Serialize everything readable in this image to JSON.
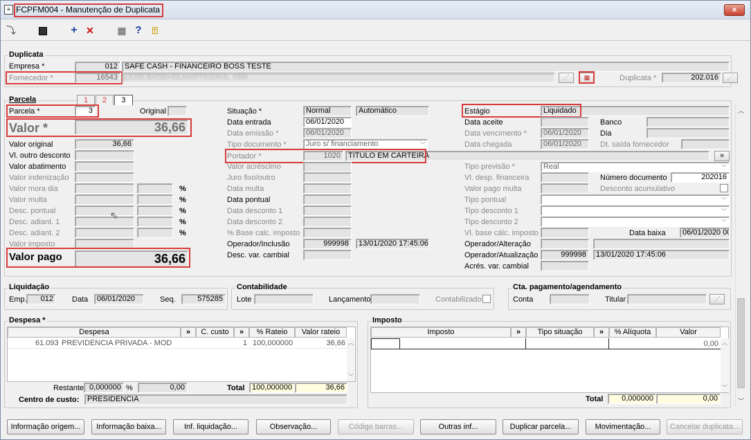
{
  "window": {
    "title": "FCPFM004 - Manutenção de Duplicata",
    "close": "×"
  },
  "toolbar": {
    "icons": [
      "goto-icon",
      "save-icon",
      "add-icon",
      "delete-icon",
      "calculator-icon",
      "help-icon",
      "exit-icon"
    ],
    "glyphs": {
      "goto": "⤵",
      "save": "💾",
      "add": "+",
      "delete": "✕",
      "calc": "▦",
      "help": "?",
      "exit": "⍐"
    }
  },
  "duplicata": {
    "section": "Duplicata",
    "empresa_label": "Empresa *",
    "empresa_code": "012",
    "empresa_name": "SAFE CASH - FINANCEIRO BOSS TESTE",
    "fornecedor_label": "Fornecedor *",
    "fornecedor_code": "16543",
    "fornecedor_name": "LKSR BXDEHDLMXPTEIDR4L XBR",
    "duplicata_label": "Duplicata *",
    "duplicata_value": "202.016"
  },
  "parcela": {
    "section": "Parcela",
    "tabs": [
      "1",
      "2",
      "3"
    ],
    "parcela_label": "Parcela *",
    "parcela_value": "3",
    "original_label": "Original",
    "valor_label": "Valor *",
    "valor_value": "36,66",
    "valor_original_label": "Valor original",
    "valor_original": "36,66",
    "left_labels": [
      "Vl. outro desconto",
      "Valor abatimento",
      "Valor indenização",
      "Valor mora dia",
      "Valor multa",
      "Desc. pontual",
      "Desc. adiant. 1",
      "Desc. adiant. 2",
      "Valor imposto"
    ],
    "pct": "%",
    "valor_pago_label": "Valor pago",
    "valor_pago_value": "36,66",
    "situacao_label": "Situação *",
    "situacao_value": "Normal",
    "situacao_tipo": "Automático",
    "data_entrada_label": "Data entrada",
    "data_entrada": "06/01/2020",
    "data_emissao_label": "Data emissão *",
    "data_emissao": "06/01/2020",
    "tipo_documento_label": "Tipo documento *",
    "tipo_documento": "Juro s/ financiamento",
    "portador_label": "Portador *",
    "portador_code": "1020",
    "portador_name": "TITULO EM CARTEIRA",
    "mid_labels": [
      "Valor acréscimo",
      "Juro fixo/outro",
      "Data multa",
      "Data pontual",
      "Data desconto 1",
      "Data desconto 2",
      "% Base calc. imposto"
    ],
    "operador_inclusao_label": "Operador/Inclusão",
    "operador_inclusao": "999998",
    "operador_inclusao_data": "13/01/2020 17:45:06",
    "desc_var_cambial_label": "Desc. var. cambial",
    "estagio_label": "Estágio",
    "estagio_value": "Liquidado",
    "data_aceite_label": "Data aceite",
    "banco_label": "Banco",
    "data_vencimento_label": "Data vencimento *",
    "data_vencimento": "06/01/2020",
    "dia_label": "Dia",
    "data_chegada_label": "Data chegada",
    "data_chegada": "06/01/2020",
    "dt_saida_label": "Dt. saída fornecedor",
    "tipo_previsao_label": "Tipo previsão *",
    "tipo_previsao": "Real",
    "vl_desp_fin_label": "Vl. desp. financeira",
    "numero_documento_label": "Número documento",
    "numero_documento": "202016",
    "valor_pago_multa_label": "Valor pago multa",
    "desconto_acumulativo_label": "Desconto acumulativo",
    "right_labels": [
      "Tipo pontual",
      "Tipo desconto 1",
      "Tipo desconto 2",
      "Vl. base cálc. imposto"
    ],
    "data_baixa_label": "Data baixa",
    "data_baixa": "06/01/2020 00",
    "operador_alteracao_label": "Operador/Alteração",
    "operador_atualizacao_label": "Operador/Atualização",
    "operador_atualizacao": "999998",
    "operador_atualizacao_data": "13/01/2020 17:45:06",
    "acres_var_cambial_label": "Acrés. var. cambial",
    "portador_btn": "»"
  },
  "liquidacao": {
    "section": "Liquidação",
    "emp_label": "Emp.",
    "emp": "012",
    "data_label": "Data",
    "data": "06/01/2020",
    "seq_label": "Seq.",
    "seq": "575285"
  },
  "contabilidade": {
    "section": "Contabilidade",
    "lote_label": "Lote",
    "lancamento_label": "Lançamento",
    "contabilizado_label": "Contabilizado"
  },
  "cta": {
    "section": "Cta. pagamento/agendamento",
    "conta_label": "Conta",
    "titular_label": "Titular"
  },
  "despesa": {
    "section": "Despesa *",
    "headers": [
      "Despesa",
      "»",
      "C. custo",
      "»",
      "% Rateio",
      "Valor rateio"
    ],
    "rows": [
      {
        "code": "61.093",
        "name": "PREVIDENCIA PRIVADA - MOD",
        "ccusto": "1",
        "rateio": "100,000000",
        "valor": "36,66"
      }
    ],
    "restante_label": "Restante",
    "restante_pct": "0,000000",
    "pct": "%",
    "restante_val": "0,00",
    "total_label": "Total",
    "total_pct": "100,000000",
    "total_val": "36,66",
    "centro_label": "Centro de custo:",
    "centro_value": "PRESIDENCIA"
  },
  "imposto": {
    "section": "Imposto",
    "headers": [
      "Imposto",
      "»",
      "Tipo situação",
      "»",
      "% Alíquota",
      "Valor"
    ],
    "row_valor": "0,00",
    "total_label": "Total",
    "total_pct": "0,000000",
    "total_val": "0,00"
  },
  "buttons": [
    {
      "label": "Informação origem...",
      "enabled": true
    },
    {
      "label": "Informação baixa...",
      "enabled": true
    },
    {
      "label": "Inf. liquidação...",
      "enabled": true
    },
    {
      "label": "Observação...",
      "enabled": true
    },
    {
      "label": "Código barras...",
      "enabled": false
    },
    {
      "label": "Outras inf...",
      "enabled": true
    },
    {
      "label": "Duplicar parcela...",
      "enabled": true
    },
    {
      "label": "Movimentação...",
      "enabled": true
    },
    {
      "label": "Cancelar duplicata...",
      "enabled": false
    }
  ],
  "colors": {
    "highlight": "#d83a3a",
    "yellow_field": "#fffde0",
    "accent_blue": "#1a3fa8",
    "delete_red": "#cc1010"
  }
}
